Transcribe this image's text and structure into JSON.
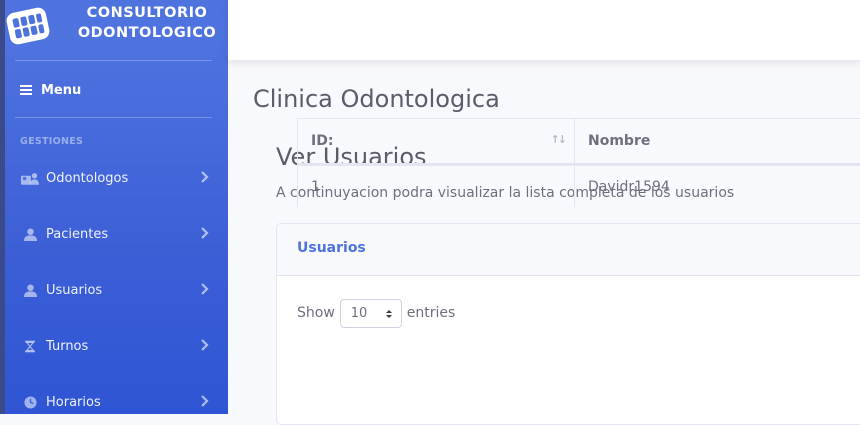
{
  "brand": {
    "line1": "CONSULTORIO",
    "line2": "ODONTOLOGICO",
    "logo_icon": "tooth-grid-icon"
  },
  "sidebar": {
    "menu_label": "Menu",
    "heading": "GESTIONES",
    "items": [
      {
        "label": "Odontologos",
        "icon": "users-icon"
      },
      {
        "label": "Pacientes",
        "icon": "user-icon"
      },
      {
        "label": "Usuarios",
        "icon": "user-icon"
      },
      {
        "label": "Turnos",
        "icon": "hourglass-icon"
      },
      {
        "label": "Horarios",
        "icon": "clock-icon"
      }
    ]
  },
  "main": {
    "page_title": "Clinica Odontologica",
    "section_title": "Ver Usuarios",
    "subtitle": "A continuyacion podra visualizar la lista completa de los usuarios"
  },
  "card": {
    "title": "Usuarios",
    "show_label": "Show",
    "entries_value": "10",
    "entries_label": "entries",
    "columns": [
      "ID:",
      "Nombre"
    ],
    "rows": [
      [
        "1",
        "Davidr1594"
      ]
    ]
  },
  "colors": {
    "sidebar": "#4e73df",
    "accent": "#4e73df",
    "text": "#5a5c69"
  }
}
